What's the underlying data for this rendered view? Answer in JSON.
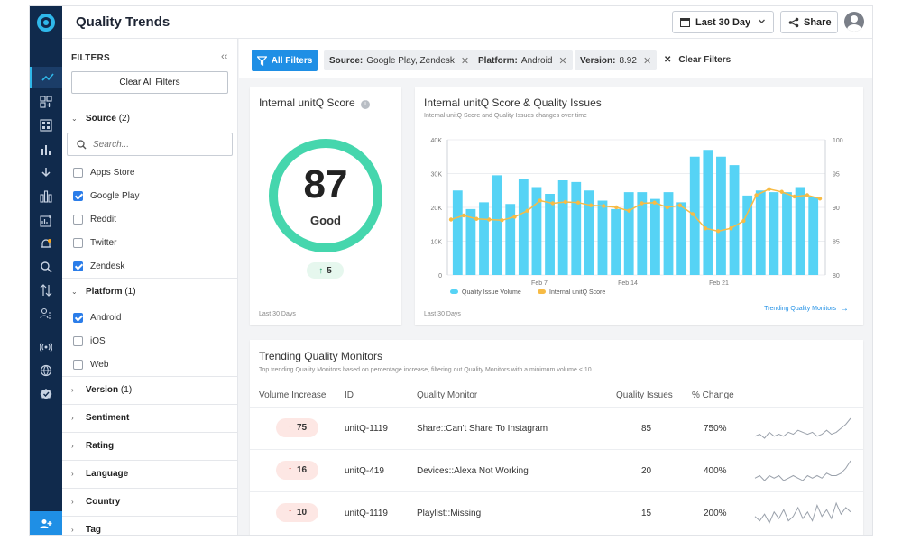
{
  "header": {
    "title": "Quality Trends",
    "date_range": "Last 30 Day",
    "share_label": "Share"
  },
  "rail": {
    "icons": [
      "trend-icon",
      "grid-add-icon",
      "apps-icon",
      "bar-chart-icon",
      "download-icon",
      "columns-icon",
      "chart-add-icon",
      "bell-icon",
      "search-icon",
      "sort-icon",
      "users-icon",
      "broadcast-icon",
      "globe-icon",
      "badge-check-icon",
      "add-user-icon"
    ]
  },
  "filters": {
    "title": "FILTERS",
    "clear_all": "Clear All Filters",
    "source": {
      "label": "Source",
      "count": "(2)",
      "search_placeholder": "Search...",
      "options": [
        {
          "label": "Apps Store",
          "checked": false
        },
        {
          "label": "Google Play",
          "checked": true
        },
        {
          "label": "Reddit",
          "checked": false
        },
        {
          "label": "Twitter",
          "checked": false
        },
        {
          "label": "Zendesk",
          "checked": true
        }
      ]
    },
    "platform": {
      "label": "Platform",
      "count": "(1)",
      "options": [
        {
          "label": "Android",
          "checked": true
        },
        {
          "label": "iOS",
          "checked": false
        },
        {
          "label": "Web",
          "checked": false
        }
      ]
    },
    "collapsed": [
      {
        "label": "Version",
        "count": "(1)"
      },
      {
        "label": "Sentiment",
        "count": ""
      },
      {
        "label": "Rating",
        "count": ""
      },
      {
        "label": "Language",
        "count": ""
      },
      {
        "label": "Country",
        "count": ""
      },
      {
        "label": "Tag",
        "count": ""
      }
    ]
  },
  "chips": {
    "all_filters": "All Filters",
    "items": [
      {
        "key": "Source:",
        "value": "Google Play, Zendesk"
      },
      {
        "key": "Platform:",
        "value": "Android"
      },
      {
        "key": "Version:",
        "value": "8.92"
      }
    ],
    "clear": "Clear Filters"
  },
  "score_card": {
    "title": "Internal unitQ Score",
    "score": "87",
    "score_fraction": 0.87,
    "rating": "Good",
    "delta": "5",
    "period": "Last 30 Days"
  },
  "chart_card": {
    "title": "Internal unitQ Score & Quality Issues",
    "subtitle": "Internal unitQ Score and Quality Issues changes over time",
    "period": "Last 30 Days",
    "link": "Trending Quality Monitors",
    "colors": {
      "bars": "#56d3f5",
      "line": "#f7bb45"
    }
  },
  "chart_data": {
    "type": "bar",
    "title": "Internal unitQ Score & Quality Issues",
    "x_ticks": [
      "Feb 7",
      "Feb 14",
      "Feb 21"
    ],
    "y_left": {
      "ticks": [
        "0",
        "10K",
        "20K",
        "30K",
        "40K"
      ],
      "ylim": [
        0,
        40000
      ]
    },
    "y_right": {
      "ticks": [
        "80",
        "85",
        "90",
        "95",
        "100"
      ],
      "ylim": [
        80,
        100
      ]
    },
    "legend": "bottom",
    "series": [
      {
        "name": "Quality Issue Volume",
        "kind": "bar",
        "values": [
          25000,
          19500,
          21500,
          29500,
          21000,
          28500,
          26000,
          24000,
          28000,
          27500,
          25000,
          22000,
          19500,
          24500,
          24500,
          22500,
          24500,
          21500,
          35000,
          37000,
          35000,
          32500,
          23500,
          25000,
          24500,
          24500,
          26000,
          23000
        ]
      },
      {
        "name": "Internal unitQ Score",
        "kind": "line",
        "values": [
          88.2,
          88.8,
          88.3,
          88.2,
          88.1,
          88.6,
          89.5,
          91.0,
          90.6,
          90.8,
          90.7,
          90.3,
          90.2,
          90.0,
          89.5,
          90.6,
          90.7,
          90.0,
          90.3,
          89.0,
          86.9,
          86.5,
          86.9,
          88.0,
          91.8,
          92.7,
          92.3,
          91.6,
          91.8,
          91.3
        ]
      }
    ]
  },
  "monitors": {
    "title": "Trending Quality Monitors",
    "subtitle": "Top trending Quality Monitors based on percentage increase, filtering out Quality Monitors with a minimum volume < 10",
    "columns": [
      "Volume Increase",
      "ID",
      "Quality Monitor",
      "Quality Issues",
      "% Change"
    ],
    "rows": [
      {
        "increase": "75",
        "id": "unitQ-1119",
        "monitor": "Share::Can't Share To Instagram",
        "issues": "85",
        "change": "750%",
        "spark": [
          3,
          4,
          2,
          5,
          3,
          4,
          3,
          5,
          4,
          6,
          5,
          4,
          5,
          3,
          4,
          6,
          4,
          5,
          7,
          9,
          12
        ]
      },
      {
        "increase": "16",
        "id": "unitQ-419",
        "monitor": "Devices::Alexa Not Working",
        "issues": "20",
        "change": "400%",
        "spark": [
          4,
          5,
          3,
          5,
          4,
          5,
          3,
          4,
          5,
          4,
          3,
          5,
          4,
          5,
          4,
          6,
          5,
          5,
          6,
          8,
          11
        ]
      },
      {
        "increase": "10",
        "id": "unitQ-1119",
        "monitor": "Playlist::Missing",
        "issues": "15",
        "change": "200%",
        "spark": [
          6,
          4,
          7,
          3,
          8,
          5,
          9,
          4,
          6,
          10,
          5,
          8,
          4,
          11,
          6,
          9,
          5,
          12,
          7,
          10,
          8
        ]
      }
    ]
  }
}
